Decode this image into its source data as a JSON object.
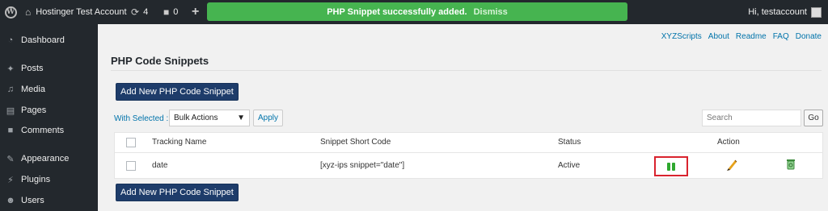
{
  "adminbar": {
    "site_name": "Hostinger Test Account",
    "updates_count": "4",
    "comments_count": "0",
    "new_label": "+",
    "notice": "PHP Snippet successfully added.",
    "dismiss": "Dismiss",
    "howdy": "Hi, testaccount"
  },
  "sidebar": {
    "items": [
      {
        "label": "Dashboard",
        "icon": "dashboard-icon"
      },
      {
        "label": "Posts",
        "icon": "pushpin-icon"
      },
      {
        "label": "Media",
        "icon": "media-icon"
      },
      {
        "label": "Pages",
        "icon": "pages-icon"
      },
      {
        "label": "Comments",
        "icon": "comment-bubble-icon"
      },
      {
        "label": "Appearance",
        "icon": "paintbrush-icon"
      },
      {
        "label": "Plugins",
        "icon": "plug-icon"
      },
      {
        "label": "Users",
        "icon": "user-icon"
      }
    ]
  },
  "content": {
    "top_links": [
      "XYZScripts",
      "About",
      "Readme",
      "FAQ",
      "Donate"
    ],
    "title": "PHP Code Snippets",
    "add_button": "Add New PHP Code Snippet",
    "with_selected": "With Selected :",
    "bulk_select": "Bulk Actions",
    "apply": "Apply",
    "search_placeholder": "Search",
    "go": "Go",
    "columns": {
      "tracking_name": "Tracking Name",
      "short_code": "Snippet Short Code",
      "status": "Status",
      "action": "Action"
    },
    "rows": [
      {
        "name": "date",
        "short_code": "[xyz-ips snippet=\"date\"]",
        "status": "Active"
      }
    ]
  },
  "colors": {
    "adminbar_bg": "#23282d",
    "notice_green": "#46b450",
    "primary_button": "#1e3c6a",
    "highlight_box": "#d9232e",
    "pause_green": "#2fa82f"
  }
}
